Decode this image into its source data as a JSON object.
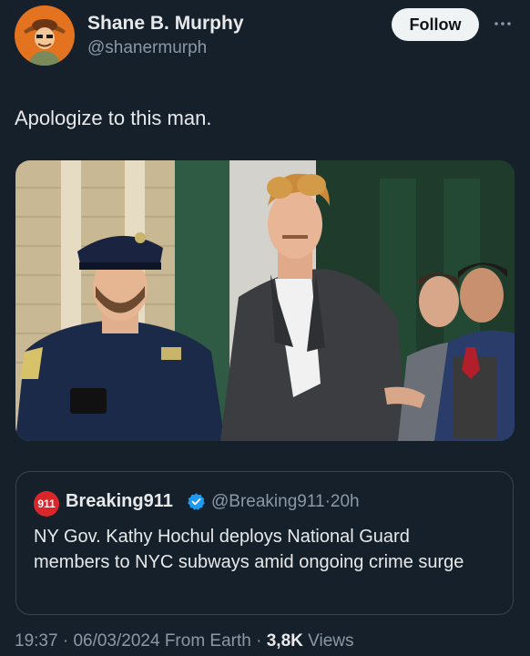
{
  "author": {
    "name": "Shane B. Murphy",
    "handle": "@shanermurph",
    "avatar_icon": "cartoon-avatar-icon"
  },
  "follow_label": "Follow",
  "more_icon": "more-horizontal-icon",
  "tweet_text": "Apologize to this man.",
  "photo": {
    "type": "news-photo"
  },
  "quote": {
    "logo_text": "911",
    "name": "Breaking911",
    "verified_icon": "verified-badge-icon",
    "handle": "@Breaking911",
    "separator": "·",
    "time": "20h",
    "text": "NY Gov. Kathy Hochul deploys National Guard members to NYC subways amid ongoing crime surge"
  },
  "meta": {
    "time": "19:37",
    "date": "06/03/2024",
    "source": "From Earth",
    "separator": "·",
    "views_count": "3,8K",
    "views_label": "Views"
  },
  "colors": {
    "background": "#15202b",
    "text_primary": "#e7e9ea",
    "text_secondary": "#8b98a5",
    "verified_blue": "#1d9bf0",
    "follow_bg": "#eff3f4"
  }
}
